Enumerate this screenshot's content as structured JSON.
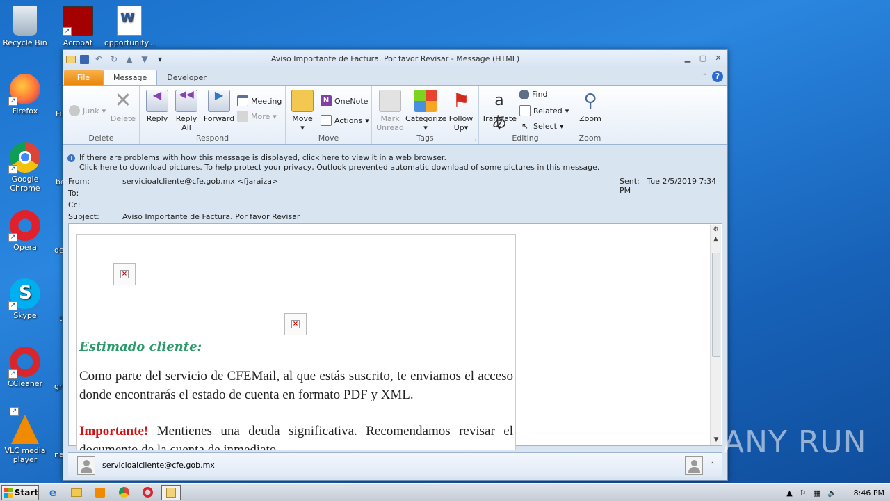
{
  "desktop": {
    "icons": [
      {
        "label": "Recycle Bin"
      },
      {
        "label": "Acrobat"
      },
      {
        "label": "opportunity..."
      },
      {
        "label": "Firefox"
      },
      {
        "label": "Google Chrome"
      },
      {
        "label": "Opera"
      },
      {
        "label": "Skype"
      },
      {
        "label": "CCleaner"
      },
      {
        "label": "VLC media player"
      }
    ],
    "partial_labels": [
      "Fi",
      "be",
      "de",
      "t",
      "gr",
      "na"
    ]
  },
  "window": {
    "title": "Aviso Importante de Factura. Por favor Revisar  -  Message (HTML)",
    "tabs": {
      "file": "File",
      "message": "Message",
      "developer": "Developer"
    }
  },
  "ribbon": {
    "delete_group": {
      "label": "Delete",
      "junk": "Junk",
      "delete": "Delete"
    },
    "respond_group": {
      "label": "Respond",
      "reply": "Reply",
      "reply_all_1": "Reply",
      "reply_all_2": "All",
      "forward": "Forward",
      "meeting": "Meeting",
      "more": "More"
    },
    "move_group": {
      "label": "Move",
      "move": "Move",
      "onenote": "OneNote",
      "actions": "Actions"
    },
    "tags_group": {
      "label": "Tags",
      "mark_unread_1": "Mark",
      "mark_unread_2": "Unread",
      "categorize": "Categorize",
      "follow_up_1": "Follow",
      "follow_up_2": "Up"
    },
    "editing_group": {
      "label": "Editing",
      "translate": "Translate",
      "find": "Find",
      "related": "Related",
      "select": "Select"
    },
    "zoom_group": {
      "label": "Zoom",
      "zoom": "Zoom"
    }
  },
  "infobar": {
    "line1": "If there are problems with how this message is displayed, click here to view it in a web browser.",
    "line2": "Click here to download pictures. To help protect your privacy, Outlook prevented automatic download of some pictures in this message."
  },
  "header": {
    "from_label": "From:",
    "from_value": "servicioalcliente@cfe.gob.mx <fjaraiza>",
    "to_label": "To:",
    "cc_label": "Cc:",
    "subject_label": "Subject:",
    "subject_value": "Aviso Importante de Factura. Por favor Revisar",
    "sent_label": "Sent:",
    "sent_value": "Tue 2/5/2019 7:34 PM"
  },
  "message": {
    "greeting": "Estimado cliente:",
    "para1": "Como parte del servicio de CFEMail, al que estás suscrito, te enviamos el acceso donde encontrarás el estado de cuenta en formato PDF y XML.",
    "important": "Importante!",
    "para2": " Mentienes una deuda significativa. Recomendamos revisar el documento de la cuenta de inmediato."
  },
  "people_pane": {
    "email": "servicioalcliente@cfe.gob.mx"
  },
  "watermark": "ANY RUN",
  "taskbar": {
    "start": "Start",
    "time": "8:46 PM"
  }
}
